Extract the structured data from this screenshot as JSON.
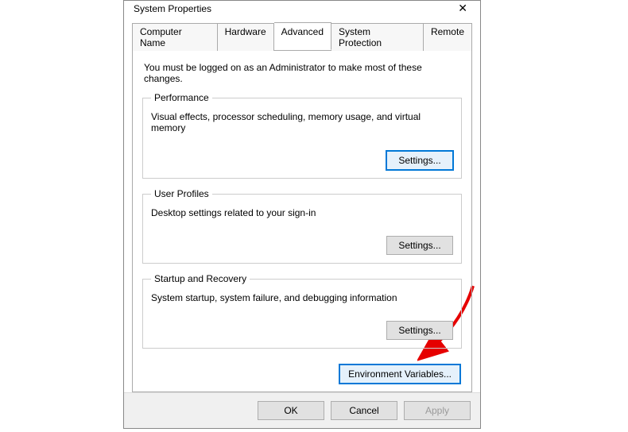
{
  "window": {
    "title": "System Properties"
  },
  "tabs": [
    {
      "label": "Computer Name"
    },
    {
      "label": "Hardware"
    },
    {
      "label": "Advanced"
    },
    {
      "label": "System Protection"
    },
    {
      "label": "Remote"
    }
  ],
  "intro": "You must be logged on as an Administrator to make most of these changes.",
  "groups": {
    "performance": {
      "legend": "Performance",
      "desc": "Visual effects, processor scheduling, memory usage, and virtual memory",
      "button": "Settings..."
    },
    "profiles": {
      "legend": "User Profiles",
      "desc": "Desktop settings related to your sign-in",
      "button": "Settings..."
    },
    "startup": {
      "legend": "Startup and Recovery",
      "desc": "System startup, system failure, and debugging information",
      "button": "Settings..."
    }
  },
  "env_button": "Environment Variables...",
  "footer": {
    "ok": "OK",
    "cancel": "Cancel",
    "apply": "Apply"
  }
}
